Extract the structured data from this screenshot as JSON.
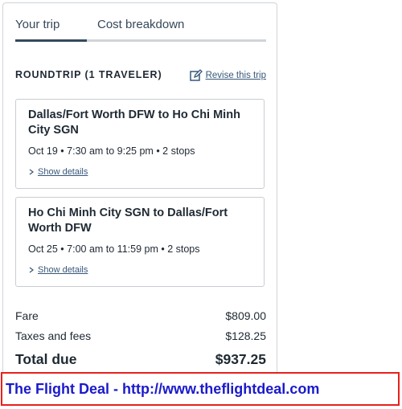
{
  "tabs": [
    {
      "label": "Your trip",
      "active": true
    },
    {
      "label": "Cost breakdown",
      "active": false
    }
  ],
  "trip": {
    "type_label": "ROUNDTRIP (1 TRAVELER)",
    "revise_label": "Revise this trip",
    "revise_icon": "edit-icon"
  },
  "flights": [
    {
      "title": "Dallas/Fort Worth DFW to Ho Chi Minh City SGN",
      "summary": "Oct 19 • 7:30 am to 9:25 pm • 2 stops",
      "details_label": "Show details"
    },
    {
      "title": "Ho Chi Minh City SGN to Dallas/Fort Worth DFW",
      "summary": "Oct 25 • 7:00 am to 11:59 pm • 2 stops",
      "details_label": "Show details"
    }
  ],
  "costs": {
    "fare_label": "Fare",
    "fare_value": "$809.00",
    "taxes_label": "Taxes and fees",
    "taxes_value": "$128.25",
    "total_label": "Total due",
    "total_value": "$937.25"
  },
  "banner": {
    "text": "The Flight Deal - http://www.theflightdeal.com"
  },
  "colors": {
    "link": "#36577a",
    "banner_border": "#e8201c",
    "banner_text": "#1a1acc",
    "tab_indicator": "#36495a"
  }
}
